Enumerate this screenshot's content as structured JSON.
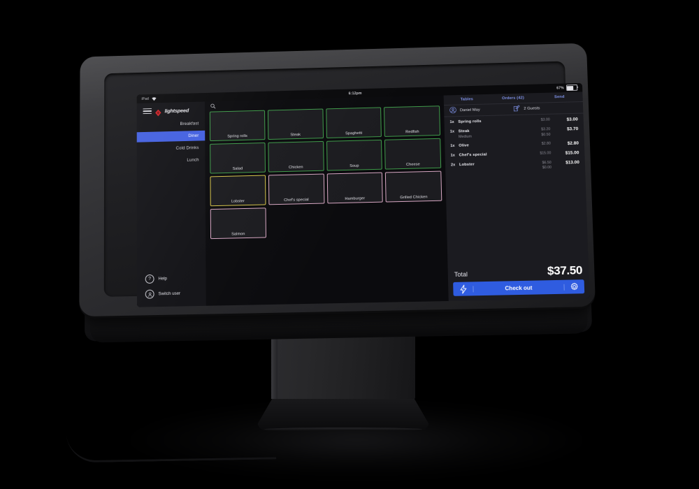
{
  "device": {
    "type": "pos-terminal-on-stand"
  },
  "status_bar": {
    "carrier_label": "iPad",
    "wifi_icon": "wifi-icon",
    "time": "6:12pm",
    "battery_percent": "67%",
    "battery_level": 67
  },
  "brand": {
    "name": "lightspeed",
    "logo_icon": "lightspeed-flame-logo",
    "menu_icon": "hamburger-menu-icon"
  },
  "sidebar": {
    "categories": [
      {
        "label": "Breakfast",
        "active": false
      },
      {
        "label": "Diner",
        "active": true
      },
      {
        "label": "Cold Drinks",
        "active": false
      },
      {
        "label": "Lunch",
        "active": false
      }
    ],
    "footer": [
      {
        "label": "Help",
        "icon": "question-mark-icon"
      },
      {
        "label": "Switch user",
        "icon": "user-avatar-icon"
      }
    ]
  },
  "search": {
    "icon": "search-icon",
    "value": "",
    "placeholder": ""
  },
  "products": [
    {
      "label": "Spring rolls",
      "color": "#3f9c4a"
    },
    {
      "label": "Steak",
      "color": "#3f9c4a"
    },
    {
      "label": "Spaghetti",
      "color": "#3f9c4a"
    },
    {
      "label": "Redfish",
      "color": "#3f9c4a"
    },
    {
      "label": "Salad",
      "color": "#3f9c4a"
    },
    {
      "label": "Chicken",
      "color": "#3f9c4a"
    },
    {
      "label": "Soup",
      "color": "#3f9c4a"
    },
    {
      "label": "Cheese",
      "color": "#3f9c4a"
    },
    {
      "label": "Lobster",
      "color": "#d8c64a"
    },
    {
      "label": "Chef's special",
      "color": "#d9a8c4"
    },
    {
      "label": "Hamburger",
      "color": "#d9a8c4"
    },
    {
      "label": "Grilled Chicken",
      "color": "#d9a8c4"
    },
    {
      "label": "Salmon",
      "color": "#d9a8c4"
    }
  ],
  "order_panel": {
    "tabs": [
      {
        "label": "Tables"
      },
      {
        "label": "Orders (42)"
      },
      {
        "label": "Send"
      }
    ],
    "customer": {
      "name": "Daniel May",
      "name_icon": "customer-avatar-icon",
      "guests": "2 Guests",
      "guests_icon": "edit-note-icon"
    },
    "items": [
      {
        "qty": "1x",
        "name": "Spring rolls",
        "modifier": "",
        "unit_prices": [
          "$3.00"
        ],
        "total": "$3.00"
      },
      {
        "qty": "1x",
        "name": "Steak",
        "modifier": "Medium",
        "unit_prices": [
          "$3.20",
          "$0.50"
        ],
        "total": "$3.70"
      },
      {
        "qty": "1x",
        "name": "Olive",
        "modifier": "",
        "unit_prices": [
          "$2.80"
        ],
        "total": "$2.80"
      },
      {
        "qty": "1x",
        "name": "Chef's special",
        "modifier": "",
        "unit_prices": [
          "$15.00"
        ],
        "total": "$15.00"
      },
      {
        "qty": "2x",
        "name": "Lobster",
        "modifier": "",
        "unit_prices": [
          "$6.50",
          "$0.00"
        ],
        "total": "$13.00"
      }
    ],
    "total": {
      "label": "Total",
      "value": "$37.50"
    },
    "checkout": {
      "quick_pay_icon": "lightning-bolt-icon",
      "label": "Check out",
      "settings_icon": "gear-icon",
      "accent_color": "#2f5ce0"
    }
  },
  "colors": {
    "accent_blue": "#4360e0",
    "button_blue": "#2f5ce0",
    "tile_green": "#3f9c4a",
    "tile_yellow": "#d8c64a",
    "tile_pink": "#d9a8c4",
    "brand_red": "#d8262c",
    "panel_bg": "#1b1b20",
    "screen_bg": "#0b0b0e"
  }
}
